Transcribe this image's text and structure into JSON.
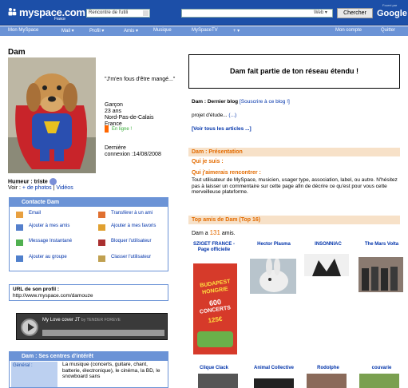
{
  "topbar": {
    "logo": "myspace.com",
    "logo_sub": "France",
    "select_value": "Rencontre de l'utili",
    "search_value": "",
    "web_select": "Web",
    "search_button": "Chercher",
    "google": "Google",
    "google_sub": "Fourni par"
  },
  "nav": {
    "items": [
      "Mon MySpace",
      "Mail ▾",
      "Profil ▾",
      "Amis ▾",
      "Musique",
      "MySpaceTV",
      "+ ▾",
      "Mon compte",
      "Quitter"
    ]
  },
  "profile": {
    "name": "Dam",
    "quote": "\"J'm'en fous d'être mangé...\"",
    "gender": "Garçon",
    "age": "23 ans",
    "region": "Nord-Pas-de-Calais",
    "country": "France",
    "online": "En ligne !",
    "last_login_label": "Dernière",
    "last_login": "connexion :14/08/2008",
    "mood": "Humeur : triste",
    "view_label": "Voir :",
    "view_photos": "+ de photos",
    "view_sep": "|",
    "view_videos": "Vidéos"
  },
  "contact": {
    "title": "Contacte Dam",
    "items": [
      {
        "label": "Email",
        "icon": "mail-icon",
        "color": "#e8a040"
      },
      {
        "label": "Transférer à un ami",
        "icon": "forward-icon",
        "color": "#e07030"
      },
      {
        "label": "Ajouter à mes amis",
        "icon": "add-friend-icon",
        "color": "#5580cc"
      },
      {
        "label": "Ajouter à mes favoris",
        "icon": "favorite-icon",
        "color": "#e0a030"
      },
      {
        "label": "Message Instantané",
        "icon": "im-icon",
        "color": "#50b050"
      },
      {
        "label": "Bloquer l'utilisateur",
        "icon": "block-icon",
        "color": "#aa3030"
      },
      {
        "label": "Ajouter au groupe",
        "icon": "group-icon",
        "color": "#5080cc"
      },
      {
        "label": "Classer l'utilisateur",
        "icon": "rank-icon",
        "color": "#c0a050"
      }
    ]
  },
  "url_box": {
    "label": "URL de son profil :",
    "url": "http://www.myspace.com/damouze"
  },
  "player": {
    "title": "My Love cover JT",
    "by": "by TENDER FOREVE"
  },
  "interests": {
    "title": "Dam : Ses centres d'intérêt",
    "label": "Général :",
    "text": "La musique (concerts, guitare, chant, batterie, électronique), le cinéma, la BD, le snowboard sans"
  },
  "extended": {
    "text": "Dam fait partie de ton réseau étendu !"
  },
  "blog": {
    "title": "Dam : Dernier blog",
    "subscribe": "[Souscrire à ce blog !]",
    "entry": "projet d'étude...",
    "entry_link": "(...)",
    "all": "[Voir tous les articles ...]"
  },
  "presentation": {
    "title": "Dam : Présentation",
    "q1": "Qui je suis :",
    "q2": "Qui j'aimerais rencontrer :",
    "text": "Tout utilisateur de MySpace, musicien, usager type, association, label, ou autre. N'hésitez pas à laisser un commentaire sur cette page afin de décrire ce qu'est pour vous cette merveilleuse plateforme."
  },
  "friends": {
    "title": "Top amis de Dam (Top 16)",
    "count_prefix": "Dam a",
    "count": "131",
    "count_suffix": "amis.",
    "row1": [
      {
        "name": "SZIGET FRANCE - Page officielle"
      },
      {
        "name": "Hector Plasma"
      },
      {
        "name": "INSONNIAC"
      },
      {
        "name": "The Mars Volta"
      }
    ],
    "poster": [
      "BUDAPEST",
      "HONGRIE",
      "600",
      "CONCERTS",
      "125€"
    ],
    "row2": [
      {
        "name": "Clique Clack"
      },
      {
        "name": "Animal Collective"
      },
      {
        "name": "Rodolphe"
      },
      {
        "name": "couvarie"
      }
    ]
  }
}
